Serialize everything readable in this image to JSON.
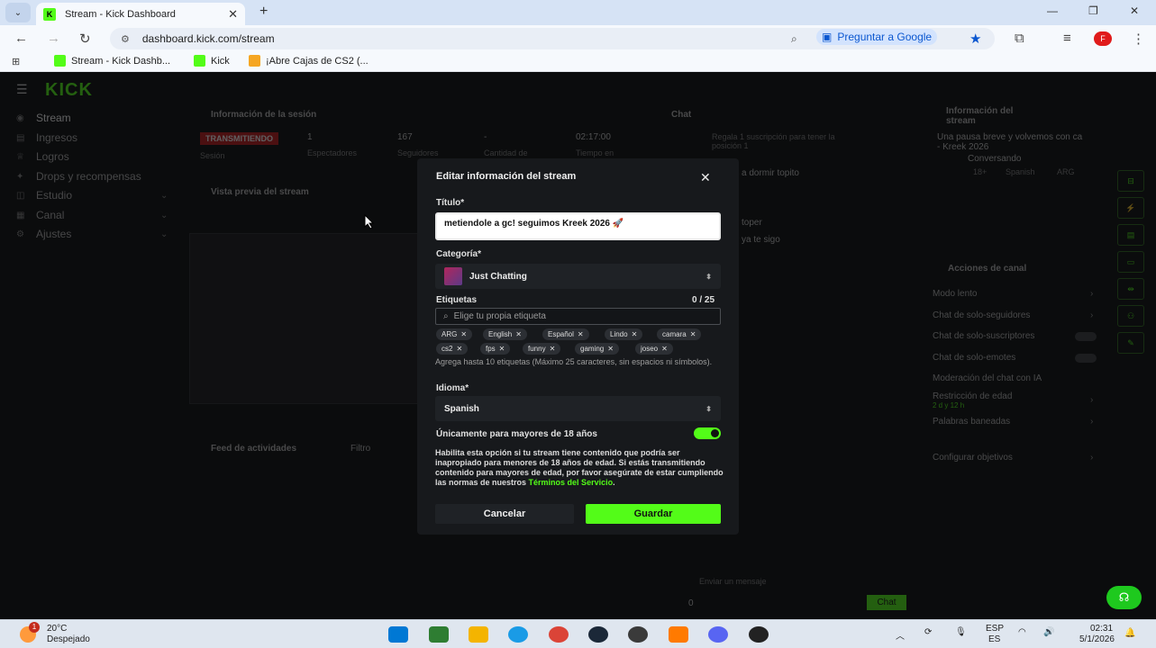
{
  "browser": {
    "tab_title": "Stream - Kick Dashboard",
    "url": "dashboard.kick.com/stream",
    "google_button": "Preguntar a Google",
    "profile_initial": "F",
    "bookmarks": [
      {
        "label": "Stream - Kick Dashb..."
      },
      {
        "label": "Kick"
      },
      {
        "label": "¡Abre Cajas de CS2 (..."
      }
    ]
  },
  "dashboard": {
    "logo": "KICK",
    "sidebar": [
      {
        "label": "Stream"
      },
      {
        "label": "Ingresos"
      },
      {
        "label": "Logros"
      },
      {
        "label": "Drops y recompensas"
      },
      {
        "label": "Estudio"
      },
      {
        "label": "Canal"
      },
      {
        "label": "Ajustes"
      }
    ],
    "session_title": "Información de la sesión",
    "live_badge": "TRANSMITIENDO",
    "stats": [
      {
        "value": "1",
        "label": "Espectadores"
      },
      {
        "value": "167",
        "label": "Seguidores"
      },
      {
        "value": "-",
        "label": "Cantidad de"
      },
      {
        "value": "02:17:00",
        "label": "Tiempo en"
      }
    ],
    "session_label": "Sesión",
    "preview_title": "Vista previa del stream",
    "activity_title": "Feed de actividades",
    "activity_filter": "Filtro",
    "chat_title": "Chat",
    "chat_notice": "Regala 1 suscripción para tener la posición 1",
    "chat_lines": [
      "a dormir topito",
      "toper",
      "ya te sigo"
    ],
    "chat_input_placeholder": "Enviar un mensaje",
    "chat_send": "Chat",
    "chat_count": "0",
    "info_title": "Información del stream",
    "info_stream_title": "Una pausa breve y volvemos con ca - Kreek 2026",
    "info_category": "Conversando",
    "info_tags": [
      "18+",
      "Spanish",
      "ARG"
    ],
    "actions_title": "Acciones de canal",
    "actions": [
      {
        "label": "Modo lento",
        "kind": "chevron"
      },
      {
        "label": "Chat de solo-seguidores",
        "kind": "chevron"
      },
      {
        "label": "Chat de solo-suscriptores",
        "kind": "toggle"
      },
      {
        "label": "Chat de solo-emotes",
        "kind": "toggle"
      },
      {
        "label": "Moderación del chat con IA",
        "kind": "none"
      },
      {
        "label": "Restricción de edad",
        "kind": "chevron"
      },
      {
        "label": "Palabras baneadas",
        "kind": "chevron"
      },
      {
        "label": "Configurar objetivos",
        "kind": "chevron"
      }
    ],
    "age_sub": "2 d y 12 h"
  },
  "modal": {
    "title": "Editar información del stream",
    "title_label": "Título*",
    "title_value": "metiendole a gc! seguimos Kreek 2026 🚀",
    "category_label": "Categoría*",
    "category_value": "Just Chatting",
    "tags_label": "Etiquetas",
    "tags_count": "0 / 25",
    "tags_placeholder": "Elige tu propia etiqueta",
    "tags": [
      "ARG",
      "English",
      "Español",
      "Lindo",
      "camara",
      "cs2",
      "fps",
      "funny",
      "gaming",
      "joseo"
    ],
    "tags_help": "Agrega hasta 10 etiquetas (Máximo 25 caracteres, sin espacios ni símbolos).",
    "language_label": "Idioma*",
    "language_value": "Spanish",
    "adult_label": "Únicamente para mayores de 18 años",
    "adult_on": true,
    "adult_desc": "Habilita esta opción si tu stream tiene contenido que podría ser inapropiado para menores de 18 años de edad. Si estás transmitiendo contenido para mayores de edad, por favor asegúrate de estar cumpliendo las normas de nuestros ",
    "adult_link": "Términos del Servicio",
    "adult_end": ".",
    "cancel": "Cancelar",
    "save": "Guardar"
  },
  "taskbar": {
    "weather_badge": "1",
    "temperature": "20°C",
    "condition": "Despejado",
    "lang_top": "ESP",
    "lang_bottom": "ES",
    "time": "02:31",
    "date": "5/1/2026"
  },
  "colors": {
    "accent": "#53fc18",
    "live": "#c41c1c",
    "modal_bg": "#17191c"
  }
}
